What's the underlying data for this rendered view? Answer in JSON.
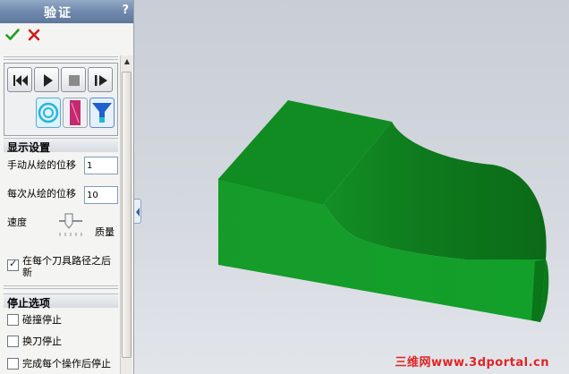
{
  "panel": {
    "title": "验证",
    "help": "?",
    "ok_icon": "green-check-icon",
    "cancel_icon": "red-x-icon"
  },
  "player": {
    "buttons": [
      "rewind-icon",
      "play-icon",
      "stop-icon",
      "step-icon"
    ],
    "tools": [
      "simulation-mode-icon",
      "stock-display-icon",
      "tool-display-icon"
    ]
  },
  "display_settings": {
    "header": "显示设置",
    "manual_step_label": "手动从绘的位移",
    "manual_step_value": "1",
    "per_step_label": "每次从绘的位移",
    "per_step_value": "10",
    "speed_label": "速度",
    "quality_label": "质量",
    "speed_level": 0.5,
    "refresh_after_each_path_label_line1": "在每个刀具路径之后",
    "refresh_after_each_path_label_line2": "新",
    "refresh_after_each_path_checked": true
  },
  "stop_options": {
    "header": "停止选项",
    "items": [
      {
        "label": "碰撞停止",
        "checked": false
      },
      {
        "label": "换刀停止",
        "checked": false
      },
      {
        "label": "完成每个操作后停止",
        "checked": false
      }
    ]
  },
  "viewport": {
    "model_color": "#1a9a2a",
    "watermark": "三维网www.3dportal.cn"
  }
}
